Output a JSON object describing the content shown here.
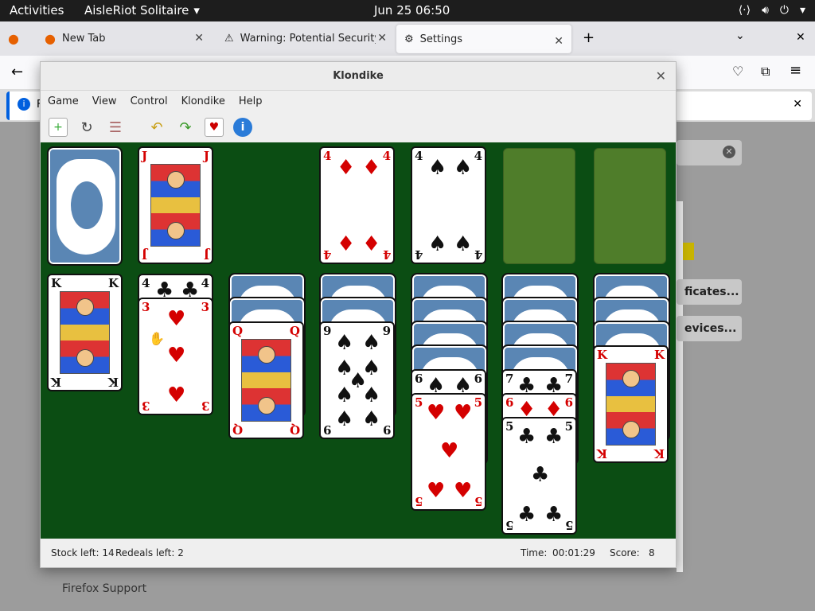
{
  "topbar": {
    "activities": "Activities",
    "app_name": "AisleRiot Solitaire",
    "clock": "Jun 25  06:50"
  },
  "firefox": {
    "tabs": [
      {
        "label": "New Tab"
      },
      {
        "label": "Warning: Potential Security R"
      },
      {
        "label": "Settings"
      }
    ],
    "info_bar_text": "F",
    "bg_buttons": [
      "ficates...",
      "evices..."
    ],
    "support_text": "Firefox Support"
  },
  "window": {
    "title": "Klondike",
    "menu": [
      "Game",
      "View",
      "Control",
      "Klondike",
      "Help"
    ],
    "status": {
      "stock": "Stock left: 14",
      "redeals": "Redeals left: 2",
      "time_label": "Time:",
      "time_value": "00:01:29",
      "score_label": "Score:",
      "score_value": "8"
    }
  },
  "cards": {
    "waste": {
      "rank": "J",
      "suit": "♦"
    },
    "f1": {
      "rank": "4",
      "suit": "♦"
    },
    "f2": {
      "rank": "4",
      "suit": "♠"
    },
    "t1": {
      "rank": "K",
      "suit": "♣"
    },
    "t2a": {
      "rank": "4",
      "suit": "♣"
    },
    "t2b": {
      "rank": "3",
      "suit": "♥"
    },
    "t3": {
      "rank": "Q",
      "suit": "♦"
    },
    "t4": {
      "rank": "9",
      "suit": "♠"
    },
    "t5a": {
      "rank": "6",
      "suit": "♠"
    },
    "t5b": {
      "rank": "5",
      "suit": "♥"
    },
    "t6a": {
      "rank": "7",
      "suit": "♣"
    },
    "t6b": {
      "rank": "6",
      "suit": "♦"
    },
    "t6c": {
      "rank": "5",
      "suit": "♣"
    },
    "t7": {
      "rank": "K",
      "suit": "♥"
    }
  }
}
